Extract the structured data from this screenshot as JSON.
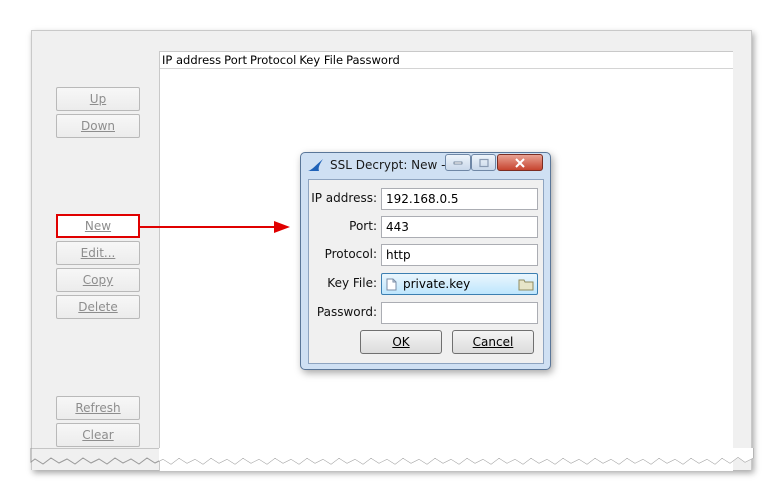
{
  "list": {
    "columns": [
      "IP address",
      "Port",
      "Protocol",
      "Key File",
      "Password"
    ]
  },
  "sidebar": {
    "up": "Up",
    "down": "Down",
    "new": "New",
    "edit": "Edit...",
    "copy": "Copy",
    "delete": "Delete",
    "refresh": "Refresh",
    "clear": "Clear"
  },
  "dialog": {
    "title": "SSL Decrypt: New -...",
    "ip_label": "IP address:",
    "ip_value": "192.168.0.5",
    "port_label": "Port:",
    "port_value": "443",
    "protocol_label": "Protocol:",
    "protocol_value": "http",
    "keyfile_label": "Key File:",
    "keyfile_value": "private.key",
    "password_label": "Password:",
    "password_value": "",
    "ok": "OK",
    "cancel": "Cancel"
  },
  "colors": {
    "highlight": "#e00000",
    "dialog_frame": "#cfe0f3",
    "close_button": "#c6442f"
  }
}
